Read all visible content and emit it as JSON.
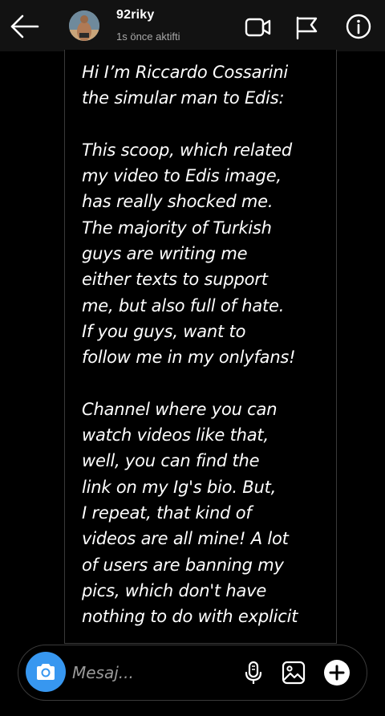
{
  "header": {
    "username": "92riky",
    "activity": "1s önce aktifti",
    "back_icon": "arrow-left-icon",
    "actions": [
      "video-call-icon",
      "flag-icon",
      "info-icon"
    ]
  },
  "message": {
    "text": "Hi I’m Riccardo Cossarini\nthe simular man to Edis:\n\nThis scoop, which related\nmy video to Edis image,\nhas really shocked me.\nThe majority of Turkish\nguys are writing me\neither texts to support\nme, but also full of hate.\nIf you guys, want to\nfollow me in my onlyfans!\n\nChannel where you can\nwatch videos like that,\nwell, you can find the\nlink on my Ig's bio. But,\nI repeat, that kind of\nvideos are all mine! A lot\nof users are banning my\npics, which don't have\nnothing to do with explicit"
  },
  "composer": {
    "placeholder": "Mesaj...",
    "value": "",
    "accent": "#3797f0",
    "icons": [
      "camera-icon",
      "microphone-icon",
      "gallery-icon",
      "plus-icon"
    ]
  },
  "colors": {
    "background": "#000000",
    "header_bg": "#121212",
    "secondary_text": "#a8a8a8",
    "border": "#3a3a3a"
  }
}
